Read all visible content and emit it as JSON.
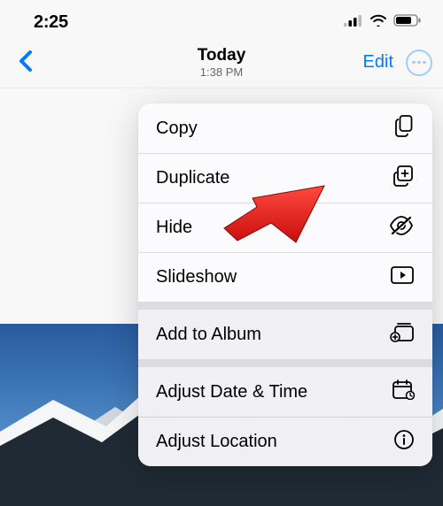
{
  "status": {
    "time": "2:25"
  },
  "nav": {
    "title": "Today",
    "subtitle": "1:38 PM",
    "edit_label": "Edit"
  },
  "menu": {
    "group_a": [
      {
        "label": "Copy",
        "icon": "copy-icon"
      },
      {
        "label": "Duplicate",
        "icon": "duplicate-icon"
      },
      {
        "label": "Hide",
        "icon": "hide-icon"
      },
      {
        "label": "Slideshow",
        "icon": "slideshow-icon"
      }
    ],
    "group_b": [
      {
        "label": "Add to Album",
        "icon": "add-to-album-icon"
      },
      {
        "label": "Adjust Date & Time",
        "icon": "calendar-icon"
      },
      {
        "label": "Adjust Location",
        "icon": "info-icon"
      }
    ]
  },
  "annotation": {
    "points_to": "hide"
  }
}
